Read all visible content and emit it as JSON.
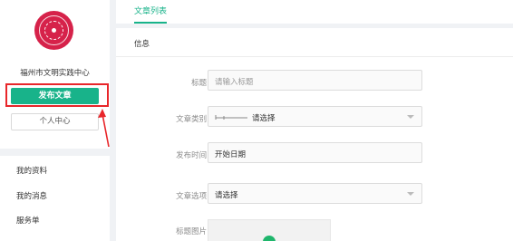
{
  "sidebar": {
    "org_name": "福州市文明实践中心",
    "publish_button": "发布文章",
    "personal_button": "个人中心",
    "menu": [
      {
        "label": "我的资料"
      },
      {
        "label": "我的消息"
      },
      {
        "label": "服务单"
      }
    ]
  },
  "header": {
    "tab": "文章列表"
  },
  "form": {
    "section_title": "信息",
    "fields": [
      {
        "label": "标题:",
        "placeholder": "请输入标题"
      },
      {
        "label": "文章类别:",
        "value": "请选择"
      },
      {
        "label": "发布时间:",
        "placeholder": "开始日期"
      },
      {
        "label": "文章选项:",
        "value": "请选择"
      },
      {
        "label": "标题图片:"
      }
    ]
  },
  "colors": {
    "accent": "#18b38a",
    "highlight": "#e8262a",
    "logo": "#d6224a"
  }
}
